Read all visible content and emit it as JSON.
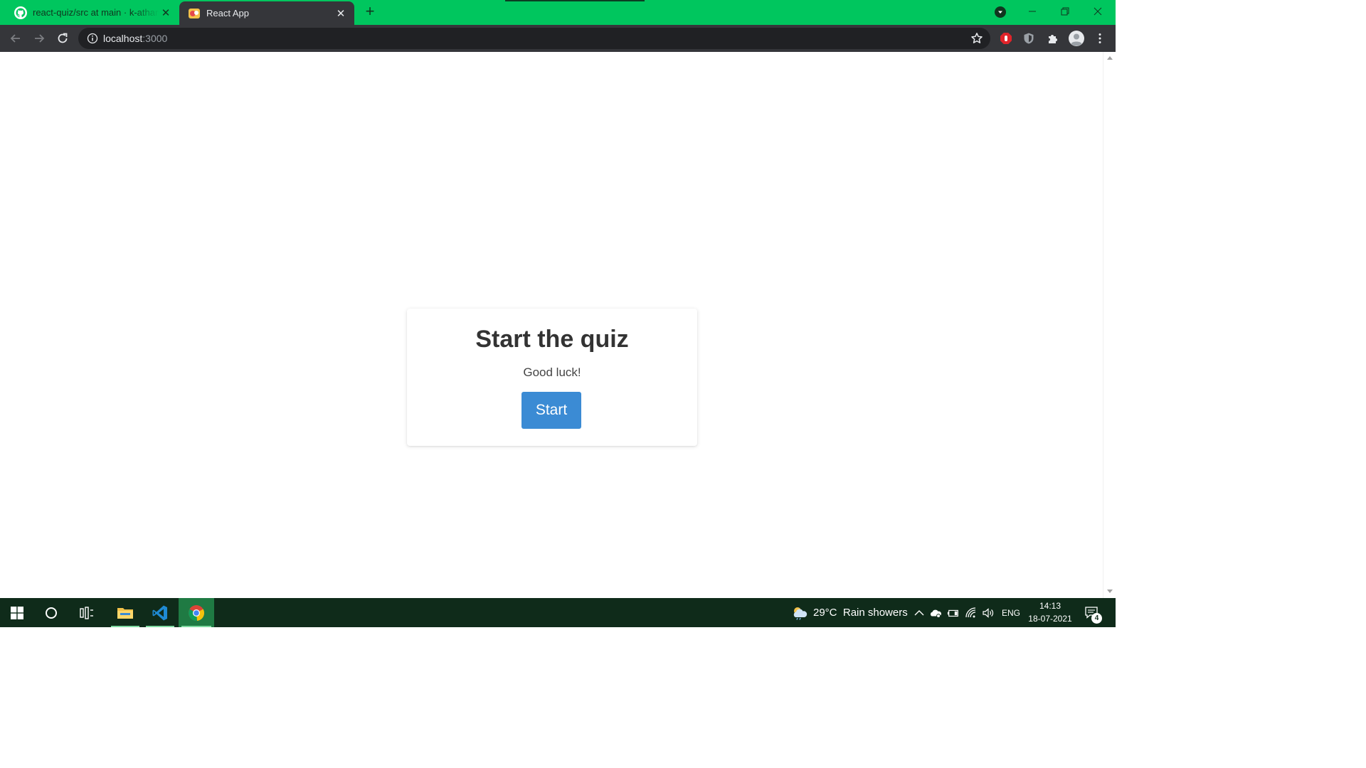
{
  "browser": {
    "tabs": [
      {
        "title": "react-quiz/src at main · k-atharva",
        "favicon": "github-icon",
        "active": false
      },
      {
        "title": "React App",
        "favicon": "react-app-favicon",
        "active": true
      }
    ],
    "new_tab_icon": "plus-icon",
    "address": {
      "host": "localhost",
      "port": ":3000"
    },
    "colors": {
      "frame": "#00c65e",
      "toolbar": "#35363a"
    }
  },
  "page": {
    "card": {
      "title": "Start the quiz",
      "subtitle": "Good luck!",
      "button_label": "Start"
    },
    "colors": {
      "button": "#3b8bd4"
    }
  },
  "taskbar": {
    "weather": {
      "temp": "29°C",
      "condition": "Rain showers"
    },
    "language": "ENG",
    "clock": {
      "time": "14:13",
      "date": "18-07-2021"
    },
    "notification_count": "4"
  }
}
